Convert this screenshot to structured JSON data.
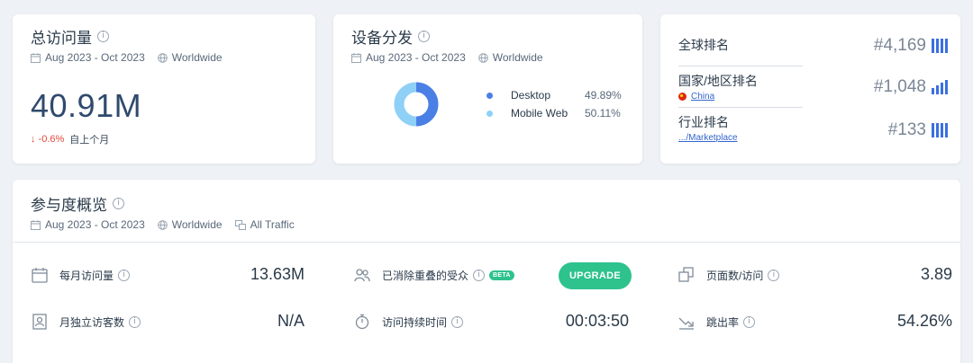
{
  "meta_common": {
    "date_range": "Aug 2023 - Oct 2023",
    "region": "Worldwide"
  },
  "visits": {
    "title": "总访问量",
    "value": "40.91M",
    "delta": "↓ -0.6%",
    "delta_label": "自上个月"
  },
  "device": {
    "title": "设备分发",
    "items": [
      {
        "name": "Desktop",
        "pct": "49.89%",
        "value": 49.89,
        "color": "#4a7fe5"
      },
      {
        "name": "Mobile Web",
        "pct": "50.11%",
        "value": 50.11,
        "color": "#8fd0f7"
      }
    ]
  },
  "rank": {
    "global": {
      "label": "全球排名",
      "value": "#4,169"
    },
    "country": {
      "label": "国家/地区排名",
      "sub": "China",
      "value": "#1,048"
    },
    "industry": {
      "label": "行业排名",
      "sub": ".../Marketplace",
      "value": "#133"
    }
  },
  "engagement": {
    "title": "参与度概览",
    "traffic": "All Traffic",
    "monthly_visits": {
      "label": "每月访问量",
      "value": "13.63M"
    },
    "unique_visitors": {
      "label": "月独立访客数",
      "value": "N/A"
    },
    "dedup_audience": {
      "label": "已消除重叠的受众",
      "badge": "BETA",
      "button": "UPGRADE"
    },
    "visit_duration": {
      "label": "访问持续时间",
      "value": "00:03:50"
    },
    "pages_per_visit": {
      "label": "页面数/访问",
      "value": "3.89"
    },
    "bounce_rate": {
      "label": "跳出率",
      "value": "54.26%"
    }
  },
  "colors": {
    "accent": "#2ec28d",
    "bar": "#3b6fe0",
    "negative": "#e0483d"
  }
}
